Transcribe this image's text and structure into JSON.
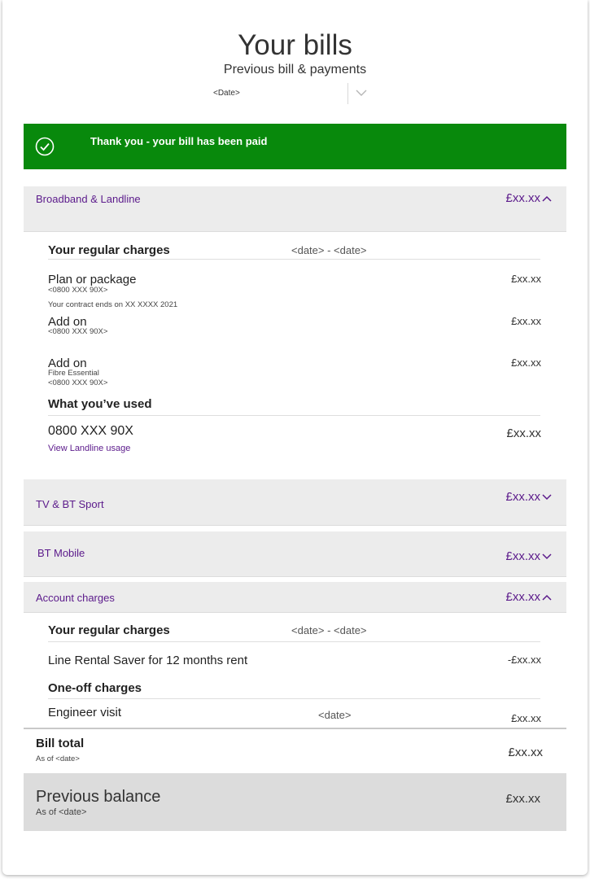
{
  "header": {
    "title": "Your bills",
    "subtitle": "Previous bill & payments",
    "date_select_value": "<Date>"
  },
  "banner": {
    "message": "Thank you - your bill has been paid",
    "icon": "check-circle-icon",
    "color": "#08890c"
  },
  "colors": {
    "accent": "#5b1a8b",
    "section_bg": "#ececec",
    "balance_bg": "#dcdcdc"
  },
  "broadband": {
    "label": "Broadband & Landline",
    "amount": "£xx.xx",
    "expanded": true,
    "regular_title": "Your regular charges",
    "regular_dates": "<date> - <date>",
    "plan": {
      "name": "Plan or package",
      "number": "<0800 XXX 90X>",
      "contract": "Your contract ends on XX XXXX 2021",
      "price": "£xx.xx"
    },
    "addon1": {
      "name": "Add on",
      "number": "<0800 XXX 90X>",
      "price": "£xx.xx"
    },
    "addon2": {
      "name": "Add on",
      "desc": "Fibre Essential",
      "number": "<0800 XXX 90X>",
      "price": "£xx.xx"
    },
    "used_title": "What you’ve used",
    "usage": {
      "number": "0800 XXX 90X",
      "link": "View Landline usage",
      "price": "£xx.xx"
    }
  },
  "tv": {
    "label": "TV & BT Sport",
    "amount": "£xx.xx",
    "expanded": false
  },
  "mobile": {
    "label": "BT Mobile",
    "amount": "£xx.xx",
    "expanded": false
  },
  "account": {
    "label": "Account charges",
    "amount": "£xx.xx",
    "expanded": true,
    "regular_title": "Your regular charges",
    "regular_dates": "<date> - <date>",
    "rental": {
      "name": "Line Rental Saver for 12 months rent",
      "price": "-£xx.xx"
    },
    "oneoff_title": "One-off charges",
    "engineer": {
      "name": "Engineer visit",
      "date": "<date>",
      "price": "£xx.xx"
    }
  },
  "bill_total": {
    "label": "Bill total",
    "sub": "As of <date>",
    "amount": "£xx.xx"
  },
  "previous_balance": {
    "label": "Previous balance",
    "sub": "As of <date>",
    "amount": "£xx.xx"
  }
}
